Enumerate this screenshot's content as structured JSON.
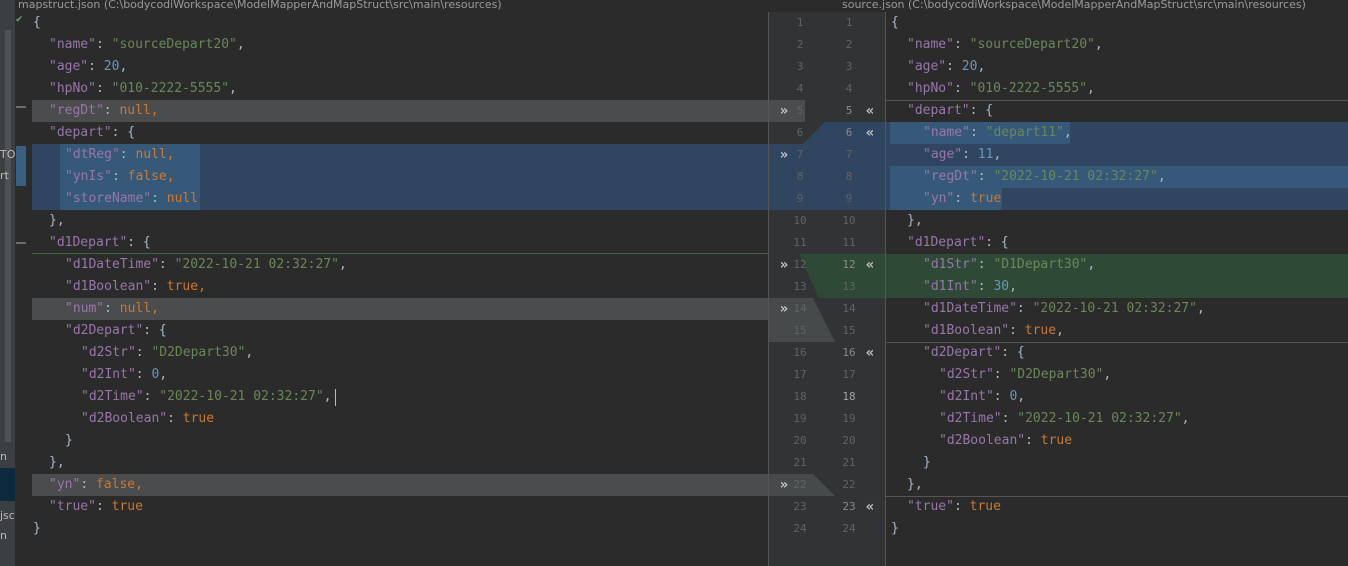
{
  "left_header": "mapstruct.json (C:\\bodycodiWorkspace\\ModelMapperAndMapStruct\\src\\main\\resources)",
  "right_header": "source.json (C:\\bodycodiWorkspace\\ModelMapperAndMapStruct\\src\\main\\resources)",
  "sidebar_fragments": [
    "TO",
    "rt",
    "n",
    "jsc",
    "n"
  ],
  "left_lines": [
    [
      [
        "{",
        "p"
      ]
    ],
    [
      [
        "\"name\"",
        "k"
      ],
      [
        ": ",
        "p"
      ],
      [
        "\"sourceDepart20\"",
        "s"
      ],
      [
        ",",
        "p"
      ]
    ],
    [
      [
        "\"age\"",
        "k"
      ],
      [
        ": ",
        "p"
      ],
      [
        "20",
        "n"
      ],
      [
        ",",
        "p"
      ]
    ],
    [
      [
        "\"hpNo\"",
        "k"
      ],
      [
        ": ",
        "p"
      ],
      [
        "\"010-2222-5555\"",
        "s"
      ],
      [
        ",",
        "p"
      ]
    ],
    [
      [
        "\"regDt\"",
        "k"
      ],
      [
        ": ",
        "p"
      ],
      [
        "null",
        "kw"
      ],
      [
        ",",
        "kw"
      ]
    ],
    [
      [
        "\"depart\"",
        "k"
      ],
      [
        ": {",
        "p"
      ]
    ],
    [
      [
        "\"dtReg\"",
        "k"
      ],
      [
        ": ",
        "p"
      ],
      [
        "null",
        "kw"
      ],
      [
        ",",
        "kw"
      ]
    ],
    [
      [
        "\"ynIs\"",
        "k"
      ],
      [
        ": ",
        "p"
      ],
      [
        "false",
        "kw"
      ],
      [
        ",",
        "kw"
      ]
    ],
    [
      [
        "\"storeName\"",
        "k"
      ],
      [
        ": ",
        "p"
      ],
      [
        "null",
        "kw"
      ]
    ],
    [
      [
        "},",
        "p"
      ]
    ],
    [
      [
        "\"d1Depart\"",
        "k"
      ],
      [
        ": {",
        "p"
      ]
    ],
    [
      [
        "\"d1DateTime\"",
        "k"
      ],
      [
        ": ",
        "p"
      ],
      [
        "\"2022-10-21 02:32:27\"",
        "s"
      ],
      [
        ",",
        "p"
      ]
    ],
    [
      [
        "\"d1Boolean\"",
        "k"
      ],
      [
        ": ",
        "p"
      ],
      [
        "true",
        "kw"
      ],
      [
        ",",
        "kw"
      ]
    ],
    [
      [
        "\"num\"",
        "k"
      ],
      [
        ": ",
        "p"
      ],
      [
        "null",
        "kw"
      ],
      [
        ",",
        "kw"
      ]
    ],
    [
      [
        "\"d2Depart\"",
        "k"
      ],
      [
        ": {",
        "p"
      ]
    ],
    [
      [
        "\"d2Str\"",
        "k"
      ],
      [
        ": ",
        "p"
      ],
      [
        "\"D2Depart30\"",
        "s"
      ],
      [
        ",",
        "p"
      ]
    ],
    [
      [
        "\"d2Int\"",
        "k"
      ],
      [
        ": ",
        "p"
      ],
      [
        "0",
        "n"
      ],
      [
        ",",
        "p"
      ]
    ],
    [
      [
        "\"d2Time\"",
        "k"
      ],
      [
        ": ",
        "p"
      ],
      [
        "\"2022-10-21 02:32:27\"",
        "s"
      ],
      [
        ",",
        "p"
      ]
    ],
    [
      [
        "\"d2Boolean\"",
        "k"
      ],
      [
        ": ",
        "p"
      ],
      [
        "true",
        "kw"
      ]
    ],
    [
      [
        "}",
        "p"
      ]
    ],
    [
      [
        "},",
        "p"
      ]
    ],
    [
      [
        "\"yn\"",
        "k"
      ],
      [
        ": ",
        "p"
      ],
      [
        "false",
        "kw"
      ],
      [
        ",",
        "kw"
      ]
    ],
    [
      [
        "\"true\"",
        "k"
      ],
      [
        ": ",
        "p"
      ],
      [
        "true",
        "kw"
      ]
    ],
    [
      [
        "}",
        "p"
      ]
    ]
  ],
  "right_lines": [
    [
      [
        "{",
        "p"
      ]
    ],
    [
      [
        "\"name\"",
        "k"
      ],
      [
        ": ",
        "p"
      ],
      [
        "\"sourceDepart20\"",
        "s"
      ],
      [
        ",",
        "p"
      ]
    ],
    [
      [
        "\"age\"",
        "k"
      ],
      [
        ": ",
        "p"
      ],
      [
        "20",
        "n"
      ],
      [
        ",",
        "p"
      ]
    ],
    [
      [
        "\"hpNo\"",
        "k"
      ],
      [
        ": ",
        "p"
      ],
      [
        "\"010-2222-5555\"",
        "s"
      ],
      [
        ",",
        "p"
      ]
    ],
    [
      [
        "\"depart\"",
        "k"
      ],
      [
        ": {",
        "p"
      ]
    ],
    [
      [
        "\"name\"",
        "k"
      ],
      [
        ": ",
        "p"
      ],
      [
        "\"depart11\"",
        "s"
      ],
      [
        ",",
        "p"
      ]
    ],
    [
      [
        "\"age\"",
        "k"
      ],
      [
        ": ",
        "p"
      ],
      [
        "11",
        "n"
      ],
      [
        ",",
        "p"
      ]
    ],
    [
      [
        "\"regDt\"",
        "k"
      ],
      [
        ": ",
        "p"
      ],
      [
        "\"2022-10-21 02:32:27\"",
        "s"
      ],
      [
        ",",
        "p"
      ]
    ],
    [
      [
        "\"yn\"",
        "k"
      ],
      [
        ": ",
        "p"
      ],
      [
        "true",
        "kw"
      ]
    ],
    [
      [
        "},",
        "p"
      ]
    ],
    [
      [
        "\"d1Depart\"",
        "k"
      ],
      [
        ": {",
        "p"
      ]
    ],
    [
      [
        "\"d1Str\"",
        "k"
      ],
      [
        ": ",
        "p"
      ],
      [
        "\"D1Depart30\"",
        "s"
      ],
      [
        ",",
        "p"
      ]
    ],
    [
      [
        "\"d1Int\"",
        "k"
      ],
      [
        ": ",
        "p"
      ],
      [
        "30",
        "n"
      ],
      [
        ",",
        "p"
      ]
    ],
    [
      [
        "\"d1DateTime\"",
        "k"
      ],
      [
        ": ",
        "p"
      ],
      [
        "\"2022-10-21 02:32:27\"",
        "s"
      ],
      [
        ",",
        "p"
      ]
    ],
    [
      [
        "\"d1Boolean\"",
        "k"
      ],
      [
        ": ",
        "p"
      ],
      [
        "true",
        "kw"
      ],
      [
        ",",
        "p"
      ]
    ],
    [
      [
        "\"d2Depart\"",
        "k"
      ],
      [
        ": {",
        "p"
      ]
    ],
    [
      [
        "\"d2Str\"",
        "k"
      ],
      [
        ": ",
        "p"
      ],
      [
        "\"D2Depart30\"",
        "s"
      ],
      [
        ",",
        "p"
      ]
    ],
    [
      [
        "\"d2Int\"",
        "k"
      ],
      [
        ": ",
        "p"
      ],
      [
        "0",
        "n"
      ],
      [
        ",",
        "p"
      ]
    ],
    [
      [
        "\"d2Time\"",
        "k"
      ],
      [
        ": ",
        "p"
      ],
      [
        "\"2022-10-21 02:32:27\"",
        "s"
      ],
      [
        ",",
        "p"
      ]
    ],
    [
      [
        "\"d2Boolean\"",
        "k"
      ],
      [
        ": ",
        "p"
      ],
      [
        "true",
        "kw"
      ]
    ],
    [
      [
        "}",
        "p"
      ]
    ],
    [
      [
        "},",
        "p"
      ]
    ],
    [
      [
        "\"true\"",
        "k"
      ],
      [
        ": ",
        "p"
      ],
      [
        "true",
        "kw"
      ]
    ],
    [
      [
        "}",
        "p"
      ]
    ]
  ],
  "line_numbers_left": [
    "1",
    "2",
    "3",
    "4",
    "5",
    "6",
    "7",
    "8",
    "9",
    "10",
    "11",
    "12",
    "13",
    "14",
    "15",
    "16",
    "17",
    "18",
    "19",
    "20",
    "21",
    "22",
    "23",
    "24"
  ],
  "line_numbers_right": [
    "1",
    "2",
    "3",
    "4",
    "5",
    "6",
    "7",
    "8",
    "9",
    "10",
    "11",
    "12",
    "13",
    "14",
    "15",
    "16",
    "17",
    "18",
    "19",
    "20",
    "21",
    "22",
    "23",
    "24"
  ],
  "arrow_right_glyph": "»",
  "arrow_left_glyph": "«",
  "check_glyph": "✔",
  "colors": {
    "background": "#2b2b2b",
    "diff_gray": "#4a4c4d",
    "diff_blue": "#2f4560",
    "diff_green": "#2e4a36",
    "key": "#9876aa",
    "string": "#6a8759",
    "number": "#6897bb",
    "keyword": "#cc7832"
  }
}
